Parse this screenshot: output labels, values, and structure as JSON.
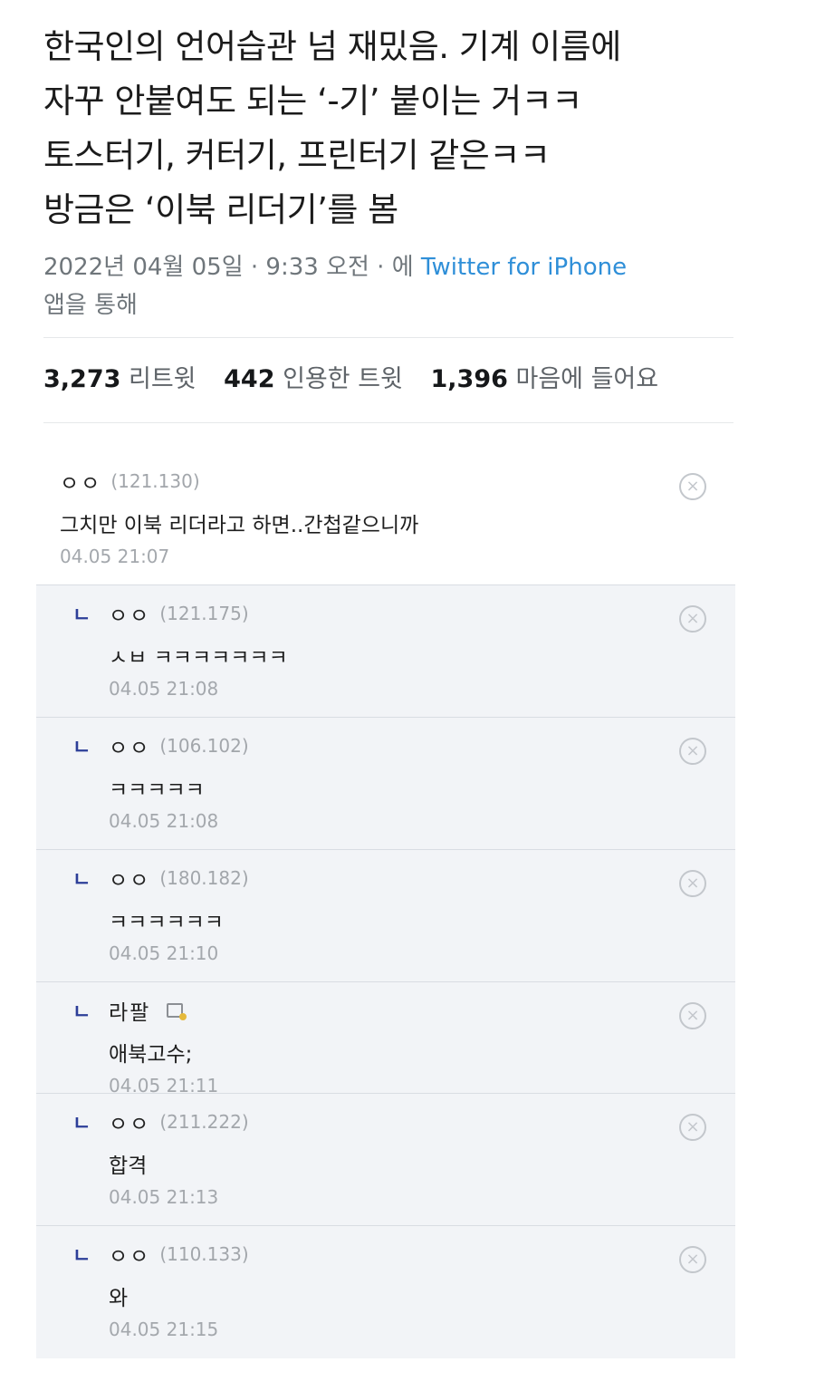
{
  "tweet": {
    "lines": [
      "한국인의 언어습관 넘 재밌음. 기계 이름에",
      "자꾸 안붙여도 되는 ‘-기’ 붙이는 거ㅋㅋ",
      "토스터기, 커터기, 프린터기 같은ㅋㅋ",
      "방금은 ‘이북 리더기’를 봄"
    ],
    "meta_prefix": "2022년 04월 05일 · 9:33 오전 · 에 ",
    "meta_link": "Twitter for iPhone",
    "meta_suffix": "앱을 통해"
  },
  "stats": {
    "retweets_count": "3,273",
    "retweets_label": "리트윗",
    "quotes_count": "442",
    "quotes_label": "인용한 트윗",
    "likes_count": "1,396",
    "likes_label": "마음에 들어요"
  },
  "comments": [
    {
      "nick": "ㅇㅇ",
      "ip": "(121.130)",
      "text": "그치만 이북 리더라고 하면..간첩같으니까",
      "date": "04.05 21:07"
    },
    {
      "nick": "ㅇㅇ",
      "ip": "(121.175)",
      "text": "ㅅㅂ ㅋㅋㅋㅋㅋㅋㅋ",
      "date": "04.05 21:08"
    },
    {
      "nick": "ㅇㅇ",
      "ip": "(106.102)",
      "text": "ㅋㅋㅋㅋㅋ",
      "date": "04.05 21:08"
    },
    {
      "nick": "ㅇㅇ",
      "ip": "(180.182)",
      "text": "ㅋㅋㅋㅋㅋㅋ",
      "date": "04.05 21:10"
    },
    {
      "nick": "라팔",
      "ip": "",
      "text": "애북고수;",
      "date": "04.05 21:11"
    },
    {
      "nick": "ㅇㅇ",
      "ip": "(211.222)",
      "text": "합격",
      "date": "04.05 21:13"
    },
    {
      "nick": "ㅇㅇ",
      "ip": "(110.133)",
      "text": "와",
      "date": "04.05 21:15"
    }
  ],
  "reply_marker": "ㄴ",
  "delete_glyph": "×",
  "colors": {
    "link": "#2f8fd8",
    "reply_bg": "#f2f4f7",
    "reply_marker": "#2c3e98"
  }
}
